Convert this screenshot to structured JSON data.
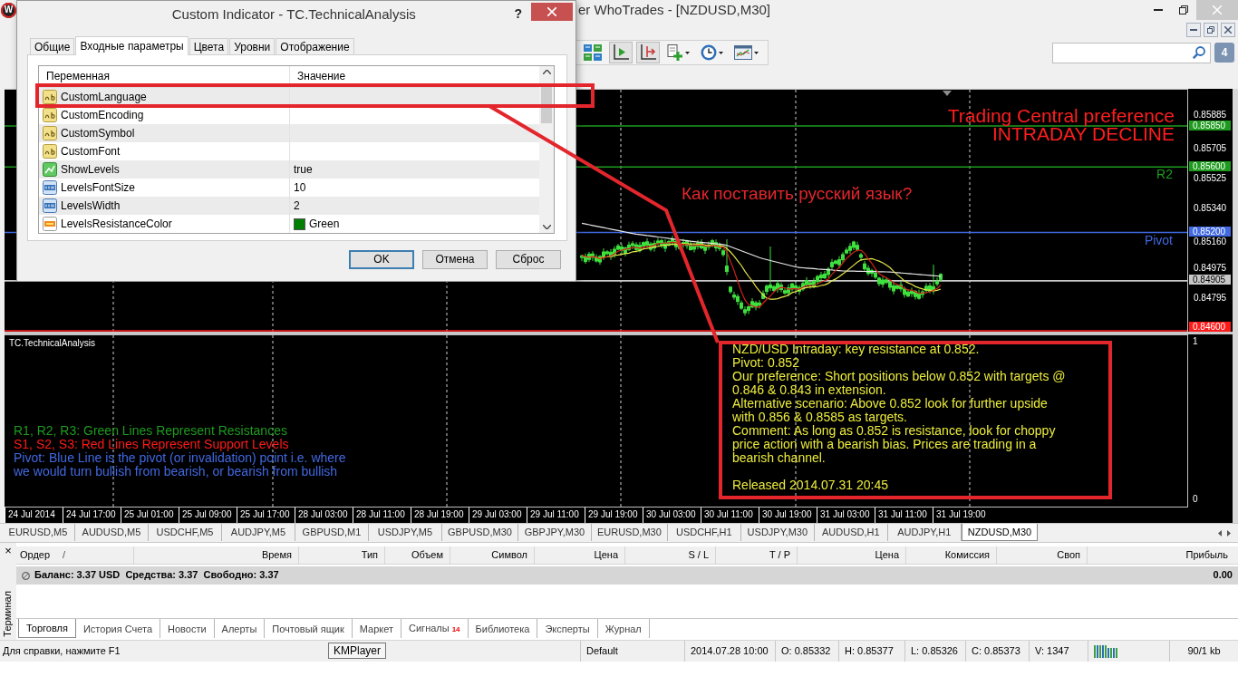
{
  "app_window": {
    "logo": "W",
    "title": "er WhoTrades - [NZDUSD,M30]"
  },
  "dialog": {
    "title": "Custom Indicator - TC.TechnicalAnalysis",
    "help": "?",
    "tabs": [
      {
        "label": "Общие",
        "selected": false
      },
      {
        "label": "Входные параметры",
        "selected": true
      },
      {
        "label": "Цвета",
        "selected": false
      },
      {
        "label": "Уровни",
        "selected": false
      },
      {
        "label": "Отображение",
        "selected": false
      }
    ],
    "columns": [
      "Переменная",
      "Значение"
    ],
    "rows": [
      {
        "kind": "string",
        "name": "CustomLanguage"
      },
      {
        "kind": "string",
        "name": "CustomEncoding"
      },
      {
        "kind": "string",
        "name": "CustomSymbol"
      },
      {
        "kind": "string",
        "name": "CustomFont"
      },
      {
        "kind": "bool",
        "name": "ShowLevels",
        "value": "true"
      },
      {
        "kind": "int",
        "name": "LevelsFontSize",
        "value": "10"
      },
      {
        "kind": "int",
        "name": "LevelsWidth",
        "value": "2"
      },
      {
        "kind": "color",
        "name": "LevelsResistanceColor",
        "value": "Green",
        "color": "#008000"
      }
    ],
    "buttons": [
      {
        "label": "OK",
        "default": true
      },
      {
        "label": "Отмена",
        "default": false
      },
      {
        "label": "Сброс",
        "default": false
      }
    ]
  },
  "toolbar": {
    "buttons": [
      {
        "kind": "tiles",
        "pressed": false
      },
      {
        "kind": "shift",
        "pressed": true
      },
      {
        "kind": "autoscroll",
        "pressed": true
      },
      {
        "kind": "indicator",
        "pressed": false
      },
      {
        "kind": "periods",
        "pressed": false
      },
      {
        "kind": "template",
        "pressed": false
      }
    ],
    "notification_count": "4"
  },
  "chart": {
    "headline": [
      "Trading Central preference",
      "INTRADAY DECLINE"
    ],
    "levels": [
      {
        "tag": "0.85850",
        "color": "#1e9b1e"
      },
      {
        "tag": "0.85600",
        "label": "R2",
        "color": "#1e9b1e"
      },
      {
        "tag": "0.85200",
        "label": "Pivot",
        "color": "#4169e1"
      },
      {
        "tag": "0.84905",
        "color": "#c8c8c8"
      },
      {
        "tag": "0.84600",
        "color": "#ff1a1a"
      }
    ],
    "price_axis": [
      "0.85885",
      "0.85705",
      "0.85525",
      "0.85340",
      "0.85160",
      "0.84975",
      "0.84795"
    ]
  },
  "annotation": {
    "question": "Как поставить русский язык?"
  },
  "indicator_window": {
    "title": "TC.TechnicalAnalysis",
    "axis": [
      "1",
      "0"
    ],
    "legend": [
      {
        "text": "R1, R2, R3: Green Lines Represent Resistances",
        "color": "#1e9b1e"
      },
      {
        "text": "S1, S2, S3: Red Lines Represent Support Levels",
        "color": "#ff1a1a"
      },
      {
        "text": "Pivot: Blue Line is the pivot (or invalidation) point i.e. where we would turn bullish from bearish, or bearish from bullish",
        "color": "#4169e1"
      }
    ],
    "analysis": [
      "NZD/USD Intraday: key resistance at 0.852.",
      "Pivot: 0.852",
      "Our preference: Short positions below 0.852 with targets @ 0.846 & 0.843 in extension.",
      "Alternative scenario: Above 0.852 look for further upside with 0.856 & 0.8585 as targets.",
      "Comment: As long as 0.852 is resistance, look for choppy price action with a bearish bias. Prices are trading in a bearish channel."
    ],
    "released": "Released 2014.07.31 20:45"
  },
  "time_axis": [
    "24 Jul 2014",
    "24 Jul 17:00",
    "25 Jul 01:00",
    "25 Jul 09:00",
    "25 Jul 17:00",
    "28 Jul 03:00",
    "28 Jul 11:00",
    "28 Jul 19:00",
    "29 Jul 03:00",
    "29 Jul 11:00",
    "29 Jul 19:00",
    "30 Jul 03:00",
    "30 Jul 11:00",
    "30 Jul 19:00",
    "31 Jul 03:00",
    "31 Jul 11:00",
    "31 Jul 19:00"
  ],
  "symbol_tabs": [
    {
      "label": "EURUSD,M5",
      "selected": false
    },
    {
      "label": "AUDUSD,M5",
      "selected": false
    },
    {
      "label": "USDCHF,M5",
      "selected": false
    },
    {
      "label": "AUDJPY,M5",
      "selected": false
    },
    {
      "label": "GBPUSD,M1",
      "selected": false
    },
    {
      "label": "USDJPY,M5",
      "selected": false
    },
    {
      "label": "GBPUSD,M30",
      "selected": false
    },
    {
      "label": "GBPJPY,M30",
      "selected": false
    },
    {
      "label": "EURUSD,M30",
      "selected": false
    },
    {
      "label": "USDCHF,H1",
      "selected": false
    },
    {
      "label": "USDJPY,M30",
      "selected": false
    },
    {
      "label": "AUDUSD,H1",
      "selected": false
    },
    {
      "label": "AUDJPY,H1",
      "selected": false
    },
    {
      "label": "NZDUSD,M30",
      "selected": true
    }
  ],
  "terminal": {
    "title": "Терминал",
    "close": "×",
    "columns": [
      "Ордер",
      "Время",
      "Тип",
      "Объем",
      "Символ",
      "Цена",
      "S / L",
      "T / P",
      "Цена",
      "Комиссия",
      "Своп",
      "Прибыль"
    ],
    "sort_mark": "/",
    "balance": {
      "text": "Баланс: 3.37 USD  Средства: 3.37  Свободно: 3.37",
      "profit": "0.00"
    },
    "tabs": [
      {
        "label": "Торговля",
        "selected": true
      },
      {
        "label": "История Счета",
        "selected": false
      },
      {
        "label": "Новости",
        "selected": false
      },
      {
        "label": "Алерты",
        "selected": false
      },
      {
        "label": "Почтовый ящик",
        "selected": false
      },
      {
        "label": "Маркет",
        "selected": false
      },
      {
        "label": "Сигналы",
        "badge": "14",
        "selected": false
      },
      {
        "label": "Библиотека",
        "selected": false
      },
      {
        "label": "Эксперты",
        "selected": false
      },
      {
        "label": "Журнал",
        "selected": false
      }
    ]
  },
  "status_bar": {
    "help": "Для справки, нажмите F1",
    "profile": "Default",
    "bar_time": "2014.07.28 10:00",
    "open": "O: 0.85332",
    "high": "H: 0.85377",
    "low": "L: 0.85326",
    "close": "C: 0.85373",
    "volume": "V: 1347",
    "traffic": "90/1 kb"
  },
  "tooltip": "KMPlayer"
}
